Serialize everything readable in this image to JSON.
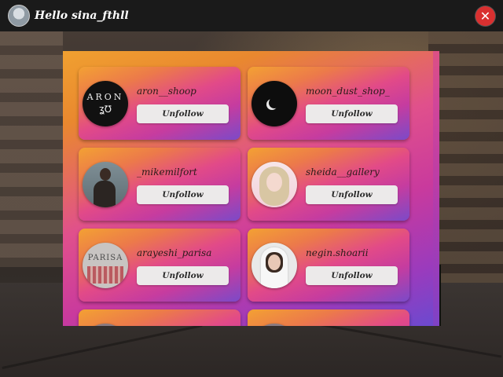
{
  "header": {
    "greeting": "Hello sina_fthll",
    "close_icon": "✕"
  },
  "accounts": [
    {
      "username": "aron__shoop",
      "button": "Unfollow",
      "avatar": "aron-logo",
      "avatar_text": "ARON"
    },
    {
      "username": "moon_dust_shop_",
      "button": "Unfollow",
      "avatar": "moon-logo"
    },
    {
      "username": "_mikemilfort",
      "button": "Unfollow",
      "avatar": "person-photo"
    },
    {
      "username": "sheida__gallery",
      "button": "Unfollow",
      "avatar": "person-photo"
    },
    {
      "username": "arayeshi_parisa",
      "button": "Unfollow",
      "avatar": "parisa-logo",
      "avatar_text": "PARISA"
    },
    {
      "username": "negin.shoarii",
      "button": "Unfollow",
      "avatar": "person-photo"
    },
    {
      "username": "",
      "button": "",
      "avatar": "person-photo"
    },
    {
      "username": "",
      "button": "",
      "avatar": "person-photo"
    }
  ],
  "colors": {
    "topbar": "#1a1a1a",
    "close": "#d93030",
    "gradient_start": "#f3a133",
    "gradient_mid": "#e24a88",
    "gradient_end": "#7b4ac8"
  }
}
